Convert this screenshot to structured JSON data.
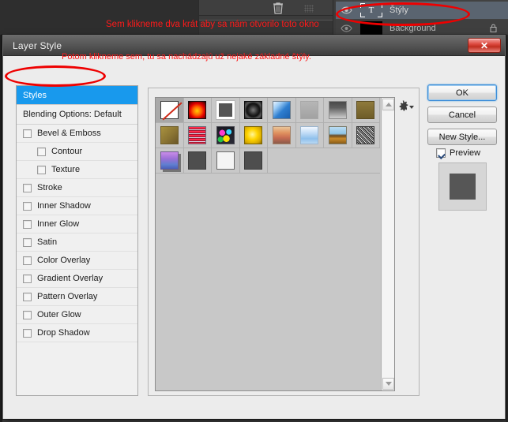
{
  "background_app": {
    "layers_panel": {
      "trash_icon": "trash-icon",
      "layers": [
        {
          "name": "Štýly",
          "thumb": "T",
          "visible": true,
          "selected": true,
          "locked": false
        },
        {
          "name": "Background",
          "thumb": "",
          "visible": true,
          "selected": false,
          "locked": true
        }
      ]
    }
  },
  "annotations": [
    {
      "id": "annot-top",
      "text": "Sem klikneme dva krát aby sa nám otvorilo toto okno",
      "color": "#ff1a1a"
    },
    {
      "id": "annot-dialog",
      "text": "Potom klikneme sem, tu sa nachádzajú už nejaké základné štýly.",
      "color": "#ff1a1a"
    }
  ],
  "dialog": {
    "title": "Layer Style",
    "close_label": "✕",
    "effects_list": [
      {
        "label": "Styles",
        "type": "selected-header",
        "checkbox": false
      },
      {
        "label": "Blending Options: Default",
        "type": "item",
        "checkbox": false
      },
      {
        "label": "Bevel & Emboss",
        "type": "item",
        "checkbox": true,
        "checked": false
      },
      {
        "label": "Contour",
        "type": "sub",
        "checkbox": true,
        "checked": false
      },
      {
        "label": "Texture",
        "type": "sub",
        "checkbox": true,
        "checked": false
      },
      {
        "label": "Stroke",
        "type": "item",
        "checkbox": true,
        "checked": false
      },
      {
        "label": "Inner Shadow",
        "type": "item",
        "checkbox": true,
        "checked": false
      },
      {
        "label": "Inner Glow",
        "type": "item",
        "checkbox": true,
        "checked": false
      },
      {
        "label": "Satin",
        "type": "item",
        "checkbox": true,
        "checked": false
      },
      {
        "label": "Color Overlay",
        "type": "item",
        "checkbox": true,
        "checked": false
      },
      {
        "label": "Gradient Overlay",
        "type": "item",
        "checkbox": true,
        "checked": false
      },
      {
        "label": "Pattern Overlay",
        "type": "item",
        "checkbox": true,
        "checked": false
      },
      {
        "label": "Outer Glow",
        "type": "item",
        "checkbox": true,
        "checked": false
      },
      {
        "label": "Drop Shadow",
        "type": "item",
        "checkbox": true,
        "checked": false
      }
    ],
    "styles_panel": {
      "legend": "Styles",
      "gear_icon": "gear-icon",
      "scrollbar": {
        "up_arrow": "chevron-up-icon",
        "down_arrow": "chevron-down-icon"
      },
      "swatches": [
        {
          "name": "Default None",
          "class": "sw-none",
          "selected": true
        },
        {
          "name": "Red Glow",
          "class": "sw-redglow",
          "selected": false
        },
        {
          "name": "White Border",
          "class": "sw-whiteborder",
          "selected": false
        },
        {
          "name": "Dark Target",
          "class": "sw-dark-target",
          "selected": false
        },
        {
          "name": "Blue Fold",
          "class": "sw-bluefold",
          "selected": false
        },
        {
          "name": "Flat Gray",
          "class": "sw-flatgray",
          "selected": false
        },
        {
          "name": "Blurred Gray",
          "class": "sw-blurgray",
          "selected": false
        },
        {
          "name": "Khaki Solid",
          "class": "sw-khaki",
          "selected": false
        },
        {
          "name": "Khaki Bevel",
          "class": "sw-khaki2",
          "selected": false
        },
        {
          "name": "Red Stripes",
          "class": "sw-redstripes",
          "selected": false
        },
        {
          "name": "Confetti",
          "class": "sw-confetti",
          "selected": false
        },
        {
          "name": "Yellow Gel",
          "class": "sw-yellow",
          "selected": false
        },
        {
          "name": "Sunset",
          "class": "sw-sunset",
          "selected": false
        },
        {
          "name": "Light Blue Glass",
          "class": "sw-lightblue",
          "selected": false
        },
        {
          "name": "Horizon",
          "class": "sw-horizon",
          "selected": false
        },
        {
          "name": "Noise Pattern",
          "class": "sw-noise",
          "selected": false
        },
        {
          "name": "Purple Shadow",
          "class": "sw-purple",
          "selected": false
        },
        {
          "name": "Gray Square",
          "class": "sw-graysq",
          "selected": false
        },
        {
          "name": "Outline Only",
          "class": "sw-outline",
          "selected": false
        },
        {
          "name": "Gray Square 2",
          "class": "sw-graysq2",
          "selected": false
        }
      ]
    },
    "buttons": {
      "ok": "OK",
      "cancel": "Cancel",
      "new_style": "New Style..."
    },
    "preview": {
      "label": "Preview",
      "checked": true,
      "swatch_color": "#565656"
    }
  },
  "colors": {
    "selection_blue": "#1899ed",
    "annotation_red": "#ff1a1a",
    "dialog_bg": "#ececec",
    "styles_bg": "#c8c8c8",
    "titlebar": "#575757",
    "close_red": "#c02e20"
  }
}
